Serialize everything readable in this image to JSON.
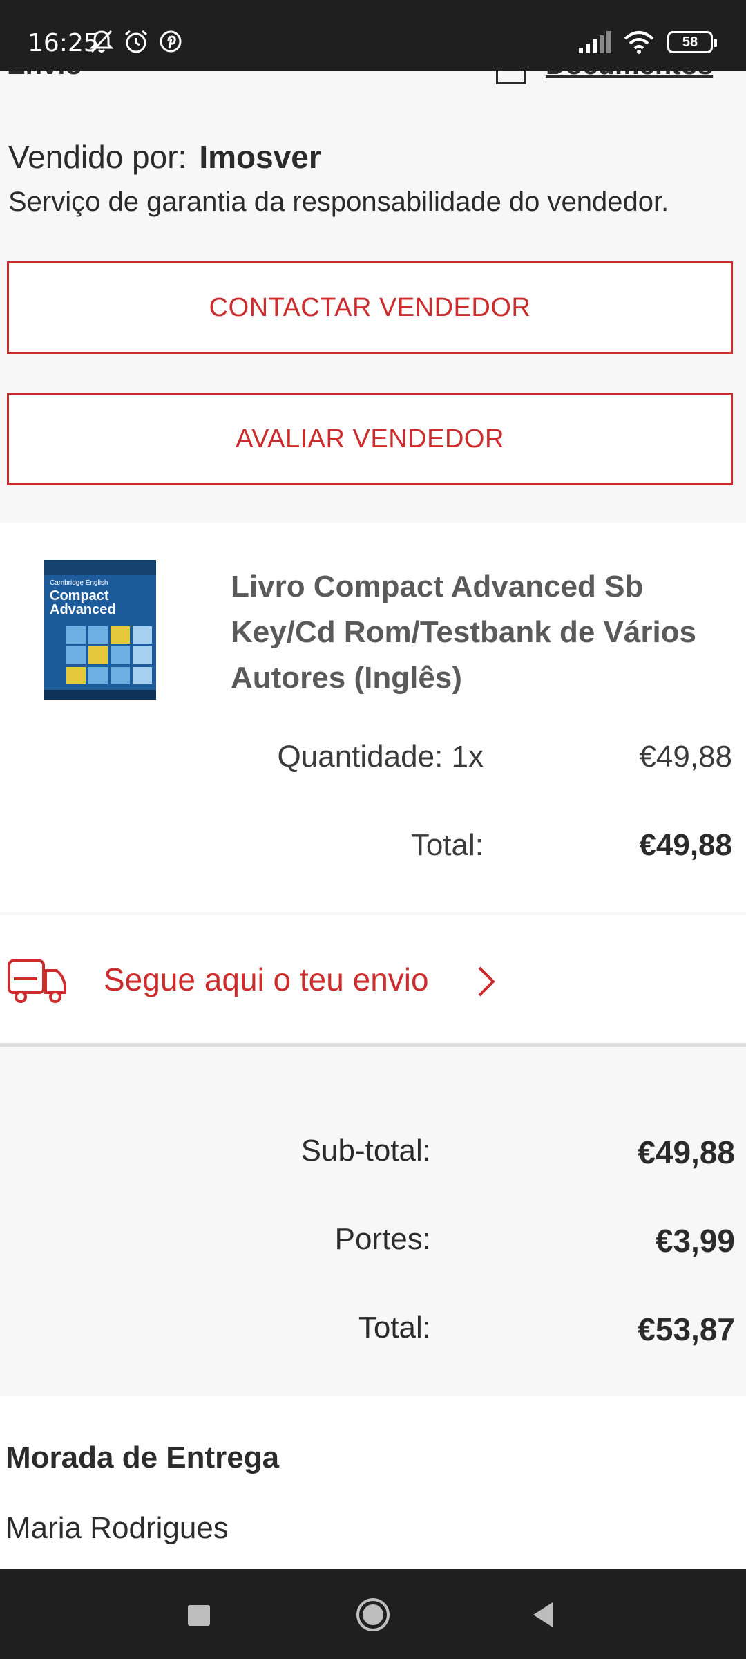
{
  "status": {
    "time": "16:25",
    "battery": "58"
  },
  "header": {
    "left": "Envio",
    "right": "Documentos"
  },
  "seller": {
    "label": "Vendido por:",
    "name": "Imosver",
    "guarantee": "Serviço de garantia da responsabilidade do vendedor.",
    "contact_button": "CONTACTAR VENDEDOR",
    "rate_button": "AVALIAR VENDEDOR"
  },
  "product": {
    "title": "Livro Compact Advanced Sb Key/Cd Rom/Testbank de Vários Autores (Inglês)",
    "cover_small": "Cambridge English",
    "cover_title": "Compact Advanced",
    "quantity_label": "Quantidade: 1x",
    "price": "€49,88",
    "total_label": "Total:",
    "total": "€49,88"
  },
  "tracking": {
    "label": "Segue aqui o teu envio"
  },
  "totals": {
    "subtotal_label": "Sub-total:",
    "subtotal": "€49,88",
    "shipping_label": "Portes:",
    "shipping": "€3,99",
    "total_label": "Total:",
    "total": "€53,87"
  },
  "address": {
    "title": "Morada de Entrega",
    "name": "Maria Rodrigues"
  },
  "colors": {
    "accent": "#cc2c2c",
    "text": "#2b2b2b",
    "background": "#f7f7f7"
  },
  "icons": [
    "notifications-off-icon",
    "alarm-icon",
    "pinterest-icon",
    "signal-icon",
    "wifi-icon",
    "battery-icon",
    "document-icon",
    "truck-icon",
    "chevron-right-icon",
    "nav-recents-icon",
    "nav-home-icon",
    "nav-back-icon"
  ]
}
